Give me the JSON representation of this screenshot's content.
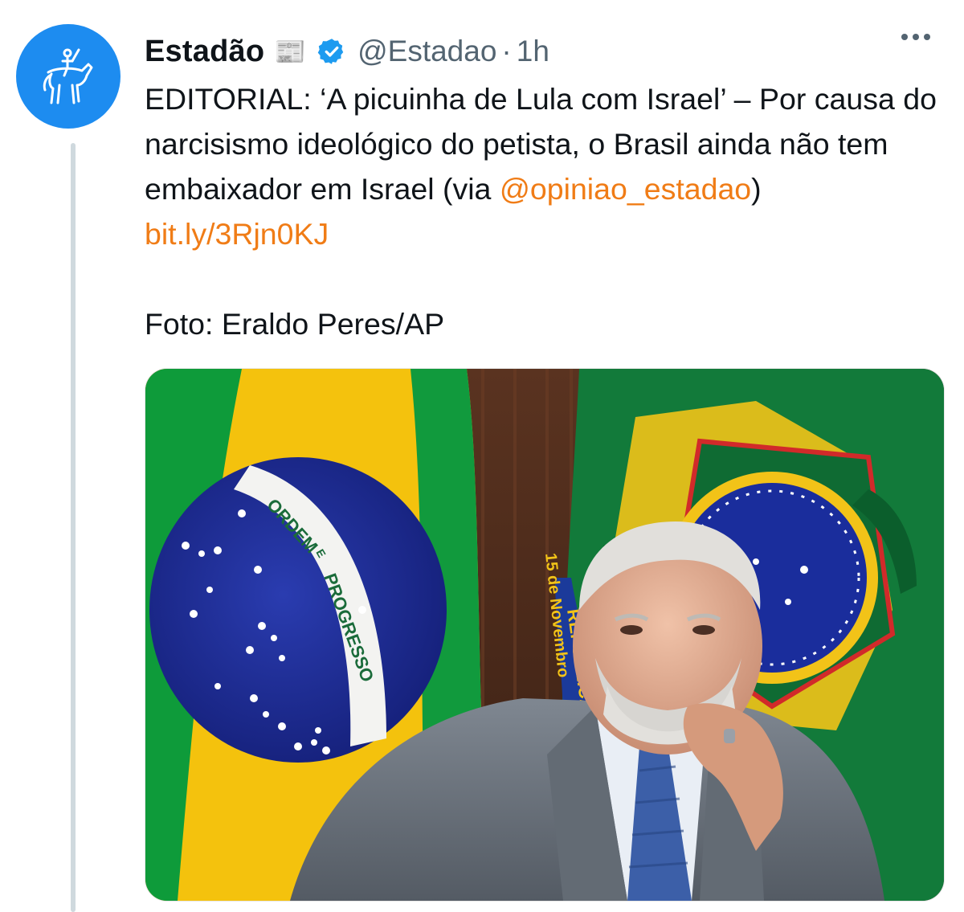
{
  "tweet": {
    "display_name": "Estadão",
    "display_badge_icon": "newspaper-emoji",
    "verified_icon": "verified-badge-icon",
    "handle": "@Estadao",
    "separator": "·",
    "time": "1h",
    "text_main": "EDITORIAL: ‘A picuinha de Lula com Israel’ – Por causa do narcisismo ideológico do petista, o Brasil ainda não tem embaixador em Israel (via ",
    "mention": "@opiniao_estadao",
    "text_after_mention": ") ",
    "link": "bit.ly/3Rjn0KJ",
    "photo_credit": "Foto: Eraldo Peres/AP"
  },
  "photo": {
    "flag_motto_1": "ORDEM",
    "flag_motto_2": "E",
    "flag_motto_3": "PROGRESSO",
    "banner_text_1": "REPÚBLICA",
    "banner_text_2": "15 de Novembro"
  },
  "colors": {
    "accent_link": "#f07c16",
    "avatar_bg": "#1d8cf0",
    "verified": "#1d9bf0",
    "secondary_text": "#536471"
  }
}
